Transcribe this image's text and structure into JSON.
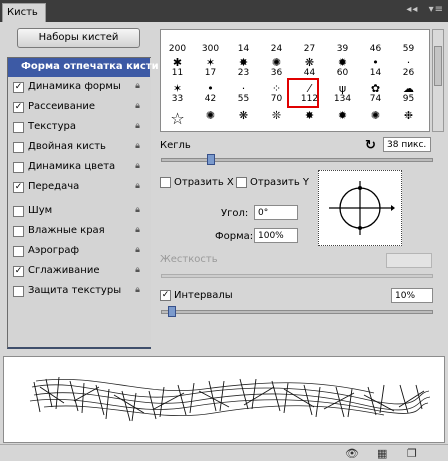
{
  "panel": {
    "tab_label": "Кисть"
  },
  "presets_button": "Наборы кистей",
  "options": [
    {
      "label": "Форма отпечатка кисти",
      "checked": null,
      "selected": true
    },
    {
      "label": "Динамика формы",
      "checked": true
    },
    {
      "label": "Рассеивание",
      "checked": true
    },
    {
      "label": "Текстура",
      "checked": false
    },
    {
      "label": "Двойная кисть",
      "checked": false
    },
    {
      "label": "Динамика цвета",
      "checked": false
    },
    {
      "label": "Передача",
      "checked": true
    },
    {
      "label": "Шум",
      "checked": false
    },
    {
      "label": "Влажные края",
      "checked": false
    },
    {
      "label": "Аэрограф",
      "checked": false
    },
    {
      "label": "Сглаживание",
      "checked": true
    },
    {
      "label": "Защита текстуры",
      "checked": false
    }
  ],
  "brush_sizes_row1": [
    "200",
    "300",
    "14",
    "24",
    "27",
    "39",
    "46",
    "59"
  ],
  "brush_sizes_row2": [
    "11",
    "17",
    "23",
    "36",
    "44",
    "60",
    "14",
    "26"
  ],
  "brush_sizes_row3": [
    "33",
    "42",
    "55",
    "70",
    "112",
    "134",
    "74",
    "95"
  ],
  "selected_brush": "112",
  "size": {
    "label": "Кегль",
    "value": "38 пикс."
  },
  "flip": {
    "x_label": "Отразить X",
    "y_label": "Отразить Y"
  },
  "angle": {
    "label": "Угол:",
    "value": "0°"
  },
  "roundness": {
    "label": "Форма:",
    "value": "100%"
  },
  "hardness": {
    "label": "Жесткость"
  },
  "spacing": {
    "label": "Интервалы",
    "checked": true,
    "value": "10%"
  },
  "icons": {
    "panel_menu": "collapse-icon",
    "reset": "reset-icon",
    "lock": "lock-icon",
    "bottom": [
      "brush-toggle-icon",
      "grid-icon",
      "new-preset-icon"
    ]
  }
}
